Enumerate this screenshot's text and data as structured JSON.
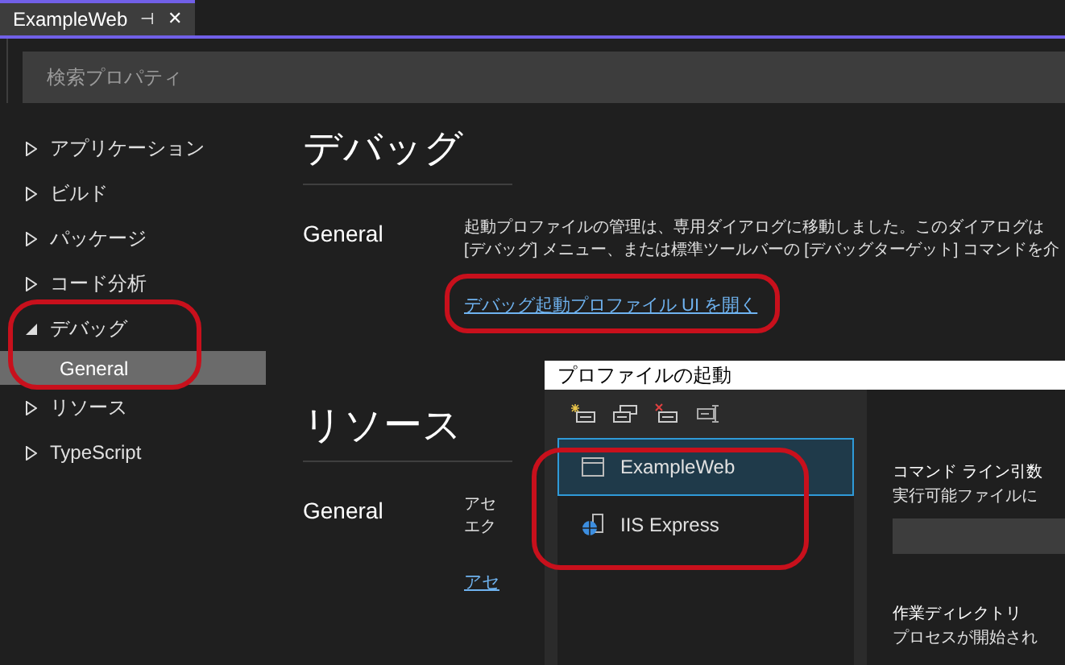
{
  "document_tab": {
    "title": "ExampleWeb",
    "pin_icon_text": "⊣",
    "close_icon_text": "✕"
  },
  "search": {
    "placeholder": "検索プロパティ"
  },
  "sidebar": {
    "items": [
      {
        "label": "アプリケーション",
        "expanded": false
      },
      {
        "label": "ビルド",
        "expanded": false
      },
      {
        "label": "パッケージ",
        "expanded": false
      },
      {
        "label": "コード分析",
        "expanded": false
      },
      {
        "label": "デバッグ",
        "expanded": true,
        "children": [
          {
            "label": "General",
            "selected": true
          }
        ]
      },
      {
        "label": "リソース",
        "expanded": false
      },
      {
        "label": "TypeScript",
        "expanded": false
      }
    ]
  },
  "sections": [
    {
      "title": "デバッグ",
      "groups": [
        {
          "label": "General",
          "lines": [
            "起動プロファイルの管理は、専用ダイアログに移動しました。このダイアログは",
            "[デバッグ] メニュー、または標準ツールバーの [デバッグターゲット] コマンドを介"
          ],
          "link": "デバッグ起動プロファイル UI を開く"
        }
      ]
    },
    {
      "title": "リソース",
      "groups": [
        {
          "label": "General",
          "lines": [
            "アセ",
            "エク"
          ],
          "link": "アセ"
        }
      ]
    }
  ],
  "dialog": {
    "title": "プロファイルの起動",
    "profiles": [
      {
        "label": "ExampleWeb",
        "kind": "project",
        "selected": true
      },
      {
        "label": "IIS Express",
        "kind": "iis",
        "selected": false
      }
    ],
    "fields": [
      {
        "label": "コマンド ライン引数",
        "description": "実行可能ファイルに",
        "has_input": true
      },
      {
        "label": "作業ディレクトリ",
        "description": "プロセスが開始され",
        "has_input": false
      }
    ]
  }
}
